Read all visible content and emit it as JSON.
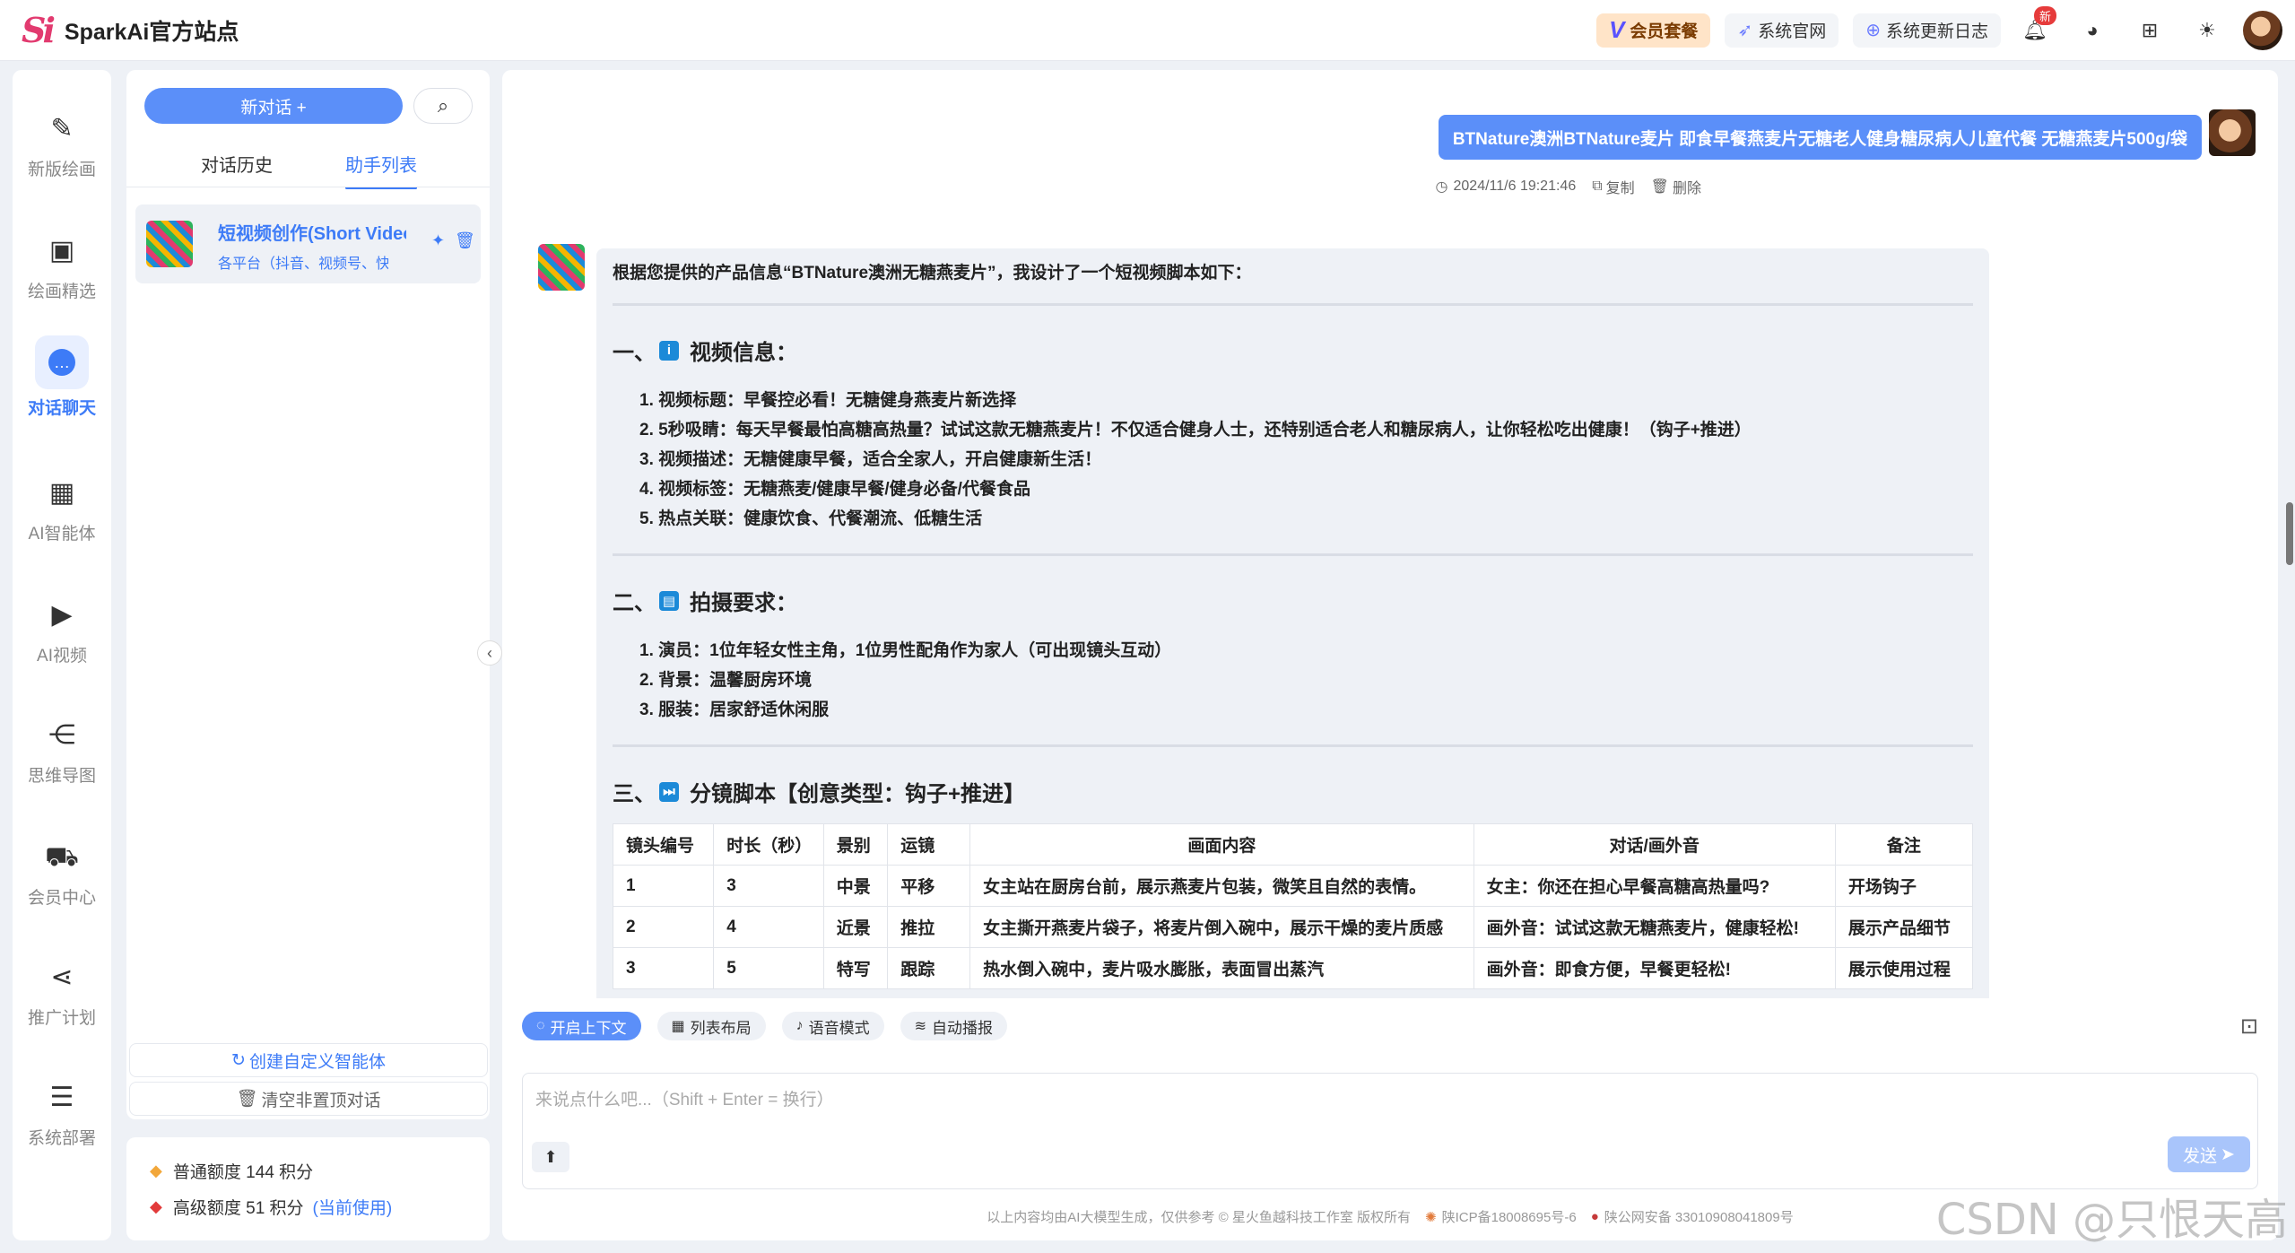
{
  "topbar": {
    "logo_mark": "Si",
    "site_name": "SparkAi官方站点",
    "vip": "会员套餐",
    "official": "系统官网",
    "changelog": "系统更新日志",
    "notify_badge": "新"
  },
  "leftnav": {
    "items": [
      {
        "label": "新版绘画"
      },
      {
        "label": "绘画精选"
      },
      {
        "label": "对话聊天"
      },
      {
        "label": "AI智能体"
      },
      {
        "label": "AI视频"
      },
      {
        "label": "思维导图"
      },
      {
        "label": "会员中心"
      },
      {
        "label": "推广计划"
      },
      {
        "label": "系统部署"
      }
    ]
  },
  "panel": {
    "new_chat": "新对话 +",
    "tabs": [
      "对话历史",
      "助手列表"
    ],
    "assistant": {
      "name": "短视频创作(Short Video",
      "desc": "各平台（抖音、视频号、快手"
    },
    "create_agent": "创建自定义智能体",
    "clear_chats": "清空非置顶对话"
  },
  "quota": {
    "normal": "普通额度 144 积分",
    "advanced": "高级额度 51 积分",
    "current": "(当前使用)"
  },
  "chat": {
    "user_message": "BTNature澳洲BTNature麦片 即食早餐燕麦片无糖老人健身糖尿病人儿童代餐 无糖燕麦片500g/袋",
    "timestamp": "2024/11/6 19:21:46",
    "copy": "复制",
    "delete": "删除",
    "intro": "根据您提供的产品信息“BTNature澳洲无糖燕麦片”，我设计了一个短视频脚本如下：",
    "section1": {
      "num": "一、",
      "title": "视频信息：",
      "items": [
        "1. 视频标题：早餐控必看！无糖健身燕麦片新选择",
        "2. 5秒吸睛：每天早餐最怕高糖高热量？试试这款无糖燕麦片！不仅适合健身人士，还特别适合老人和糖尿病人，让你轻松吃出健康！（钩子+推进）",
        "3. 视频描述：无糖健康早餐，适合全家人，开启健康新生活！",
        "4. 视频标签：无糖燕麦/健康早餐/健身必备/代餐食品",
        "5. 热点关联：健康饮食、代餐潮流、低糖生活"
      ]
    },
    "section2": {
      "num": "二、",
      "title": "拍摄要求：",
      "items": [
        "1. 演员：1位年轻女性主角，1位男性配角作为家人（可出现镜头互动）",
        "2. 背景：温馨厨房环境",
        "3. 服装：居家舒适休闲服"
      ]
    },
    "section3": {
      "num": "三、",
      "title": "分镜脚本【创意类型：钩子+推进】"
    },
    "table": {
      "headers": [
        "镜头编号",
        "时长（秒）",
        "景别",
        "运镜",
        "画面内容",
        "对话/画外音",
        "备注"
      ],
      "rows": [
        [
          "1",
          "3",
          "中景",
          "平移",
          "女主站在厨房台前，展示燕麦片包装，微笑且自然的表情。",
          "女主：你还在担心早餐高糖高热量吗?",
          "开场钩子"
        ],
        [
          "2",
          "4",
          "近景",
          "推拉",
          "女主撕开燕麦片袋子，将麦片倒入碗中，展示干燥的麦片质感",
          "画外音：试试这款无糖燕麦片，健康轻松!",
          "展示产品细节"
        ],
        [
          "3",
          "5",
          "特写",
          "跟踪",
          "热水倒入碗中，麦片吸水膨胀，表面冒出蒸汽",
          "画外音：即食方便，早餐更轻松!",
          "展示使用过程"
        ]
      ]
    }
  },
  "toolbar": {
    "context": "开启上下文",
    "layout": "列表布局",
    "voice": "语音模式",
    "autoplay": "自动播报"
  },
  "input": {
    "placeholder": "来说点什么吧...（Shift + Enter = 换行）",
    "send": "发送"
  },
  "footer": {
    "disclaimer": "以上内容均由AI大模型生成，仅供参考 © 星火鱼越科技工作室 版权所有",
    "icp": "陕ICP备18008695号-6",
    "police": "陕公网安备 33010908041809号"
  },
  "watermark": "CSDN @只恨天高"
}
